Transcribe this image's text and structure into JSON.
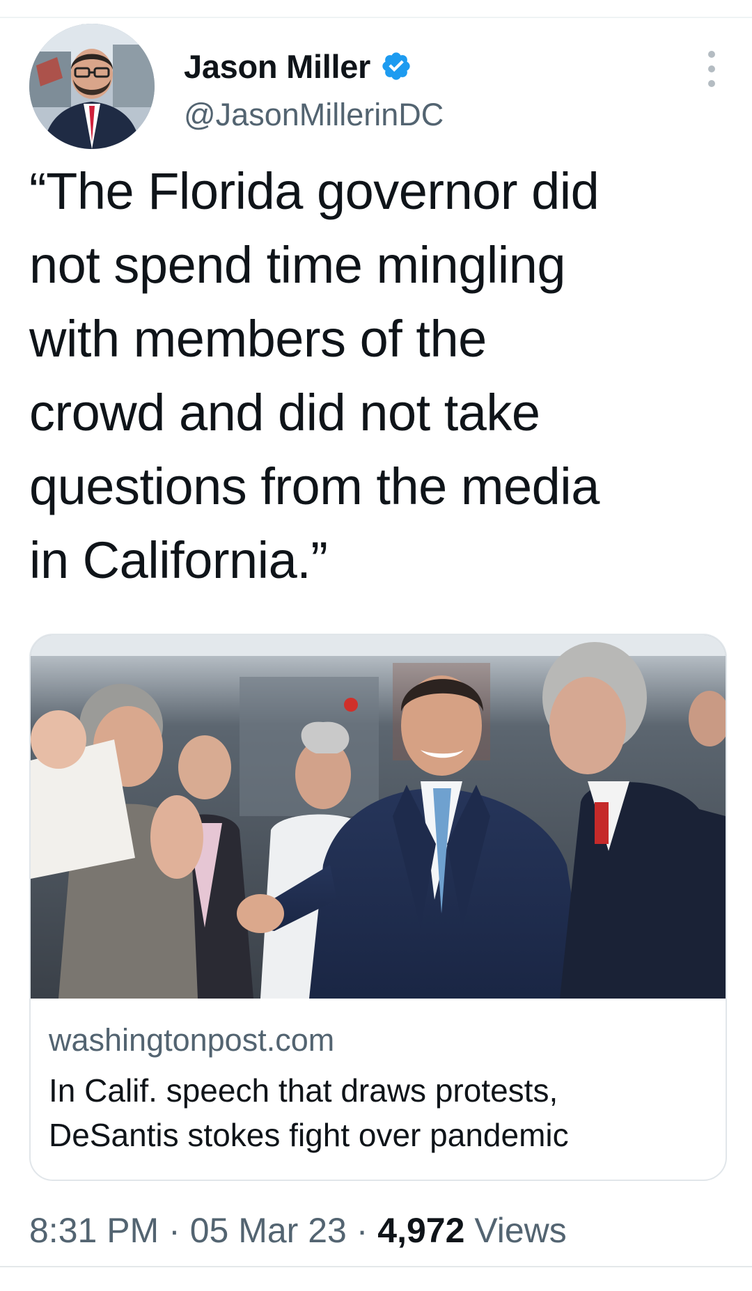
{
  "author": {
    "display_name": "Jason Miller",
    "handle": "@JasonMillerinDC",
    "avatar_icon": "profile-photo",
    "verified_icon": "verified-badge-icon",
    "verified_color": "#1d9bf0"
  },
  "tweet": {
    "lines": [
      "“The Florida governor did",
      "not spend time mingling",
      "with members of the",
      "crowd and did not take",
      "questions from the media",
      "in California.”"
    ]
  },
  "card": {
    "image_icon": "article-photo",
    "domain": "washingtonpost.com",
    "title_lines": [
      "In Calif. speech that draws protests,",
      "DeSantis stokes fight over pandemic"
    ]
  },
  "meta": {
    "time": "8:31 PM",
    "separator": "·",
    "date": "05 Mar 23",
    "views_count": "4,972",
    "views_label": "Views"
  },
  "colors": {
    "text_primary": "#0f1419",
    "text_secondary": "#536471",
    "border": "#e1e6ea"
  }
}
